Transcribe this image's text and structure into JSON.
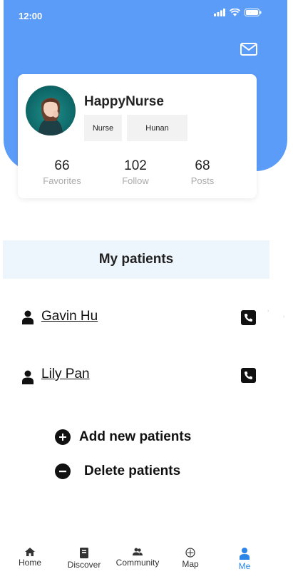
{
  "status_bar": {
    "time": "12:00"
  },
  "profile": {
    "name": "HappyNurse",
    "tags": [
      "Nurse",
      "Hunan"
    ],
    "stats": [
      {
        "value": "66",
        "label": "Favorites"
      },
      {
        "value": "102",
        "label": "Follow"
      },
      {
        "value": "68",
        "label": "Posts"
      }
    ]
  },
  "patients_section": {
    "title": "My patients",
    "patients": [
      {
        "name": "Gavin Hu"
      },
      {
        "name": "Lily Pan"
      }
    ],
    "actions": {
      "add": "Add new patients",
      "delete": "Delete patients"
    }
  },
  "tabbar": {
    "tabs": [
      {
        "label": "Home",
        "icon": "home-icon"
      },
      {
        "label": "Discover",
        "icon": "book-icon"
      },
      {
        "label": "Community",
        "icon": "people-icon"
      },
      {
        "label": "Map",
        "icon": "compass-icon"
      },
      {
        "label": "Me",
        "icon": "person-icon"
      }
    ],
    "active": "Me"
  },
  "colors": {
    "header": "#5b9cf9",
    "accent": "#2b86e8",
    "section_bg": "#eef6fd"
  }
}
